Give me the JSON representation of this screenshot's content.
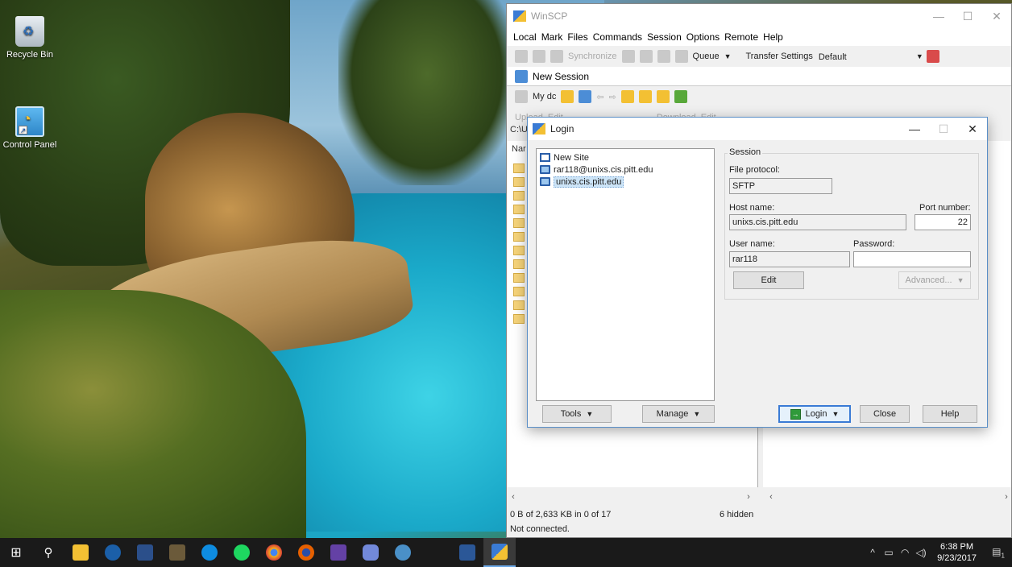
{
  "desktop": {
    "icons": [
      {
        "label": "Recycle Bin"
      },
      {
        "label": "Control Panel"
      }
    ]
  },
  "winscp": {
    "title": "WinSCP",
    "menu": [
      "Local",
      "Mark",
      "Files",
      "Commands",
      "Session",
      "Options",
      "Remote",
      "Help"
    ],
    "toolbar": {
      "synchronize": "Synchronize",
      "queue": "Queue",
      "transfer_settings_label": "Transfer Settings",
      "transfer_settings_value": "Default"
    },
    "new_session_tab": "New Session",
    "local_path_label": "My dc",
    "upload_label": "Upload",
    "edit_label": "Edit",
    "download_label": "Download",
    "path_fragment": "C:\\U",
    "name_col": "Nar",
    "status": {
      "selection": "0 B of 2,633 KB in 0 of 17",
      "hidden": "6 hidden",
      "connection": "Not connected."
    }
  },
  "login": {
    "title": "Login",
    "sites": [
      "New Site",
      "rar118@unixs.cis.pitt.edu",
      "unixs.cis.pitt.edu"
    ],
    "session_group": "Session",
    "file_protocol_label": "File protocol:",
    "file_protocol_value": "SFTP",
    "host_label": "Host name:",
    "host_value": "unixs.cis.pitt.edu",
    "port_label": "Port number:",
    "port_value": "22",
    "user_label": "User name:",
    "user_value": "rar118",
    "password_label": "Password:",
    "password_value": "",
    "edit_button": "Edit",
    "advanced_button": "Advanced...",
    "tools_button": "Tools",
    "manage_button": "Manage",
    "login_button": "Login",
    "close_button": "Close",
    "help_button": "Help"
  },
  "taskbar": {
    "time": "6:38 PM",
    "date": "9/23/2017",
    "notification_count": "1",
    "colors": {
      "explorer": "#f3c033",
      "steam": "#1b5fa8",
      "skype": "#0e8ce0",
      "spotify": "#1ed760",
      "chrome": "#f2b21c",
      "firefox": "#e66000",
      "twitch": "#6441a5",
      "discord": "#7289da",
      "word": "#2b5797",
      "winscp": "#3a7bd5"
    }
  }
}
